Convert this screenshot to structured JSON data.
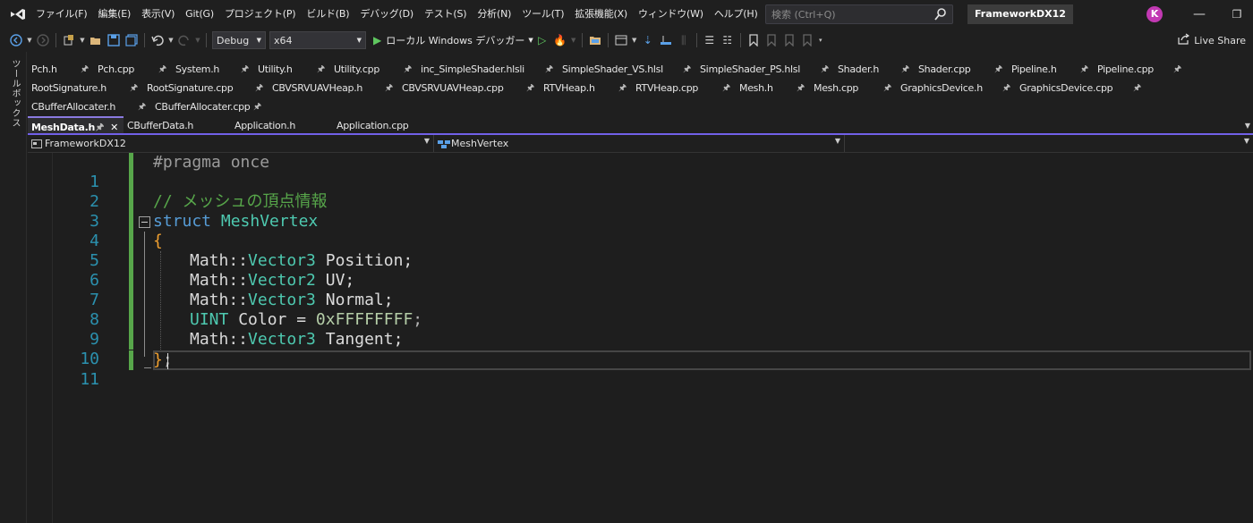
{
  "menu": {
    "items": [
      "ファイル(F)",
      "編集(E)",
      "表示(V)",
      "Git(G)",
      "プロジェクト(P)",
      "ビルド(B)",
      "デバッグ(D)",
      "テスト(S)",
      "分析(N)",
      "ツール(T)",
      "拡張機能(X)",
      "ウィンドウ(W)",
      "ヘルプ(H)"
    ],
    "search_placeholder": "検索 (Ctrl+Q)",
    "project_title": "FrameworkDX12",
    "account_initial": "K",
    "minimize_glyph": "—",
    "restore_glyph": "❐"
  },
  "toolbar": {
    "config": "Debug",
    "platform": "x64",
    "run_label": "ローカル Windows デバッガー",
    "live_share": "Live Share"
  },
  "toolbox": {
    "label": "ツールボックス"
  },
  "tabs": {
    "row1": [
      "Pch.h",
      "Pch.cpp",
      "System.h",
      "Utility.h",
      "Utility.cpp",
      "inc_SimpleShader.hlsli",
      "SimpleShader_VS.hlsl",
      "SimpleShader_PS.hlsl",
      "Shader.h",
      "Shader.cpp",
      "Pipeline.h",
      "Pipeline.cpp"
    ],
    "row2": [
      "RootSignature.h",
      "RootSignature.cpp",
      "CBVSRVUAVHeap.h",
      "CBVSRVUAVHeap.cpp",
      "RTVHeap.h",
      "RTVHeap.cpp",
      "Mesh.h",
      "Mesh.cpp",
      "GraphicsDevice.h",
      "GraphicsDevice.cpp"
    ],
    "row3": [
      "CBufferAllocater.h",
      "CBufferAllocater.cpp"
    ],
    "active": "MeshData.h",
    "row4_rest": [
      "CBufferData.h",
      "Application.h",
      "Application.cpp"
    ]
  },
  "navbar": {
    "project": "FrameworkDX12",
    "scope": "MeshVertex",
    "member": ""
  },
  "editor": {
    "line_numbers": [
      "1",
      "2",
      "3",
      "4",
      "5",
      "6",
      "7",
      "8",
      "9",
      "10",
      "11"
    ],
    "l1": "#pragma once",
    "l3": "// メッシュの頂点情報",
    "l4_kw": "struct",
    "l4_name": "MeshVertex",
    "l5": "{",
    "ns": "Math::",
    "vec3": "Vector3",
    "vec2": "Vector2",
    "l6_field": " Position;",
    "l7_field": " UV;",
    "l8_field": " Normal;",
    "l9_type": "UINT",
    "l9_field": " Color = ",
    "l9_value": "0xFFFFFFFF",
    "l9_end": ";",
    "l10_field": " Tangent;",
    "l11_brace": "}",
    "l11_end": ";"
  }
}
